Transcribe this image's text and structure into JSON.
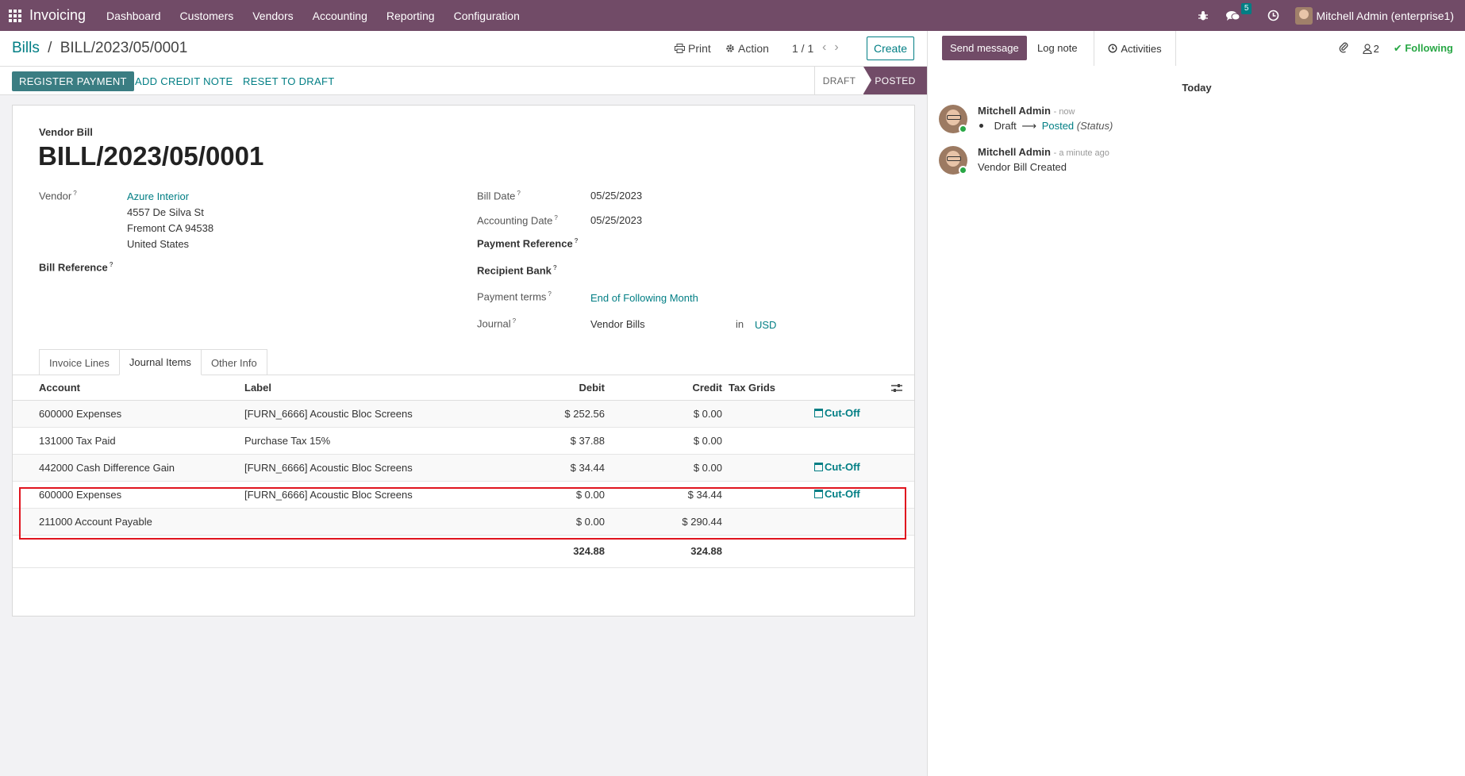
{
  "navbar": {
    "app_name": "Invoicing",
    "menu": [
      "Dashboard",
      "Customers",
      "Vendors",
      "Accounting",
      "Reporting",
      "Configuration"
    ],
    "messages_count": "5",
    "user": "Mitchell Admin (enterprise1)",
    "icons": [
      "apps-grid-icon",
      "bug-icon",
      "chat-icon",
      "clock-icon"
    ]
  },
  "breadcrumb": {
    "parent": "Bills",
    "separator": "/",
    "current": "BILL/2023/05/0001"
  },
  "control_panel": {
    "print": "Print",
    "action": "Action",
    "pager": "1 / 1",
    "create": "Create"
  },
  "statusbar": {
    "register_payment": "REGISTER PAYMENT",
    "add_credit_note": "ADD CREDIT NOTE",
    "reset_to_draft": "RESET TO DRAFT",
    "stages": [
      "DRAFT",
      "POSTED"
    ],
    "active_stage": "POSTED"
  },
  "form": {
    "type_label": "Vendor Bill",
    "name": "BILL/2023/05/0001",
    "vendor_label": "Vendor",
    "vendor_name": "Azure Interior",
    "vendor_address": [
      "4557 De Silva St",
      "Fremont CA 94538",
      "United States"
    ],
    "bill_reference_label": "Bill Reference",
    "bill_date_label": "Bill Date",
    "bill_date": "05/25/2023",
    "accounting_date_label": "Accounting Date",
    "accounting_date": "05/25/2023",
    "payment_reference_label": "Payment Reference",
    "recipient_bank_label": "Recipient Bank",
    "payment_terms_label": "Payment terms",
    "payment_terms": "End of Following Month",
    "journal_label": "Journal",
    "journal": "Vendor Bills",
    "journal_in": "in",
    "currency": "USD",
    "help_mark": "?"
  },
  "tabs": [
    "Invoice Lines",
    "Journal Items",
    "Other Info"
  ],
  "active_tab": "Journal Items",
  "journal_items": {
    "headers": [
      "Account",
      "Label",
      "Debit",
      "Credit",
      "Tax Grids"
    ],
    "rows": [
      {
        "account": "600000 Expenses",
        "label": "[FURN_6666] Acoustic Bloc Screens",
        "debit": "$ 252.56",
        "credit": "$ 0.00",
        "cutoff": "Cut-Off"
      },
      {
        "account": "131000 Tax Paid",
        "label": "Purchase Tax 15%",
        "debit": "$ 37.88",
        "credit": "$ 0.00",
        "cutoff": ""
      },
      {
        "account": "442000 Cash Difference Gain",
        "label": "[FURN_6666] Acoustic Bloc Screens",
        "debit": "$ 34.44",
        "credit": "$ 0.00",
        "cutoff": "Cut-Off"
      },
      {
        "account": "600000 Expenses",
        "label": "[FURN_6666] Acoustic Bloc Screens",
        "debit": "$ 0.00",
        "credit": "$ 34.44",
        "cutoff": "Cut-Off"
      },
      {
        "account": "211000 Account Payable",
        "label": "",
        "debit": "$ 0.00",
        "credit": "$ 290.44",
        "cutoff": ""
      }
    ],
    "total_debit": "324.88",
    "total_credit": "324.88"
  },
  "chatter": {
    "send_message": "Send message",
    "log_note": "Log note",
    "activities": "Activities",
    "followers_count": "2",
    "following": "Following",
    "date_separator": "Today",
    "messages": [
      {
        "author": "Mitchell Admin",
        "time": "- now",
        "tracking_old": "Draft",
        "tracking_new": "Posted",
        "tracking_field": "(Status)"
      },
      {
        "author": "Mitchell Admin",
        "time": "- a minute ago",
        "body": "Vendor Bill Created"
      }
    ]
  },
  "colors": {
    "brand": "#714b67",
    "accent": "#017e84",
    "highlight": "#e0141e",
    "following": "#28a745"
  }
}
